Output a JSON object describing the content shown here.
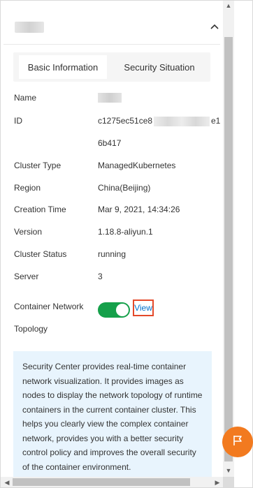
{
  "tabs": [
    {
      "label": "Basic Information",
      "active": true
    },
    {
      "label": "Security Situation",
      "active": false
    }
  ],
  "details": {
    "name_label": "Name",
    "id_label": "ID",
    "id_value_start": "c1275ec51ce8",
    "id_value_end": "e1",
    "id_value_line2": "6b417",
    "cluster_type_label": "Cluster Type",
    "cluster_type_value": "ManagedKubernetes",
    "region_label": "Region",
    "region_value": "China(Beijing)",
    "creation_time_label": "Creation Time",
    "creation_time_value": "Mar 9, 2021, 14:34:26",
    "version_label": "Version",
    "version_value": "1.18.8-aliyun.1",
    "cluster_status_label": "Cluster Status",
    "cluster_status_value": "running",
    "server_label": "Server",
    "server_value": "3",
    "container_network_label_line1": "Container Network",
    "container_network_label_line2": "Topology",
    "view_link": "View"
  },
  "toggle_on": true,
  "info_text": "Security Center provides real-time container network visualization. It provides images as nodes to display the network topology of runtime containers in the current container cluster. This helps you clearly view the complex container network, provides you with a better security control policy and improves the overall security of the container environment.",
  "colors": {
    "toggle": "#15a04a",
    "link": "#0070cc",
    "highlight_border": "#e4492a",
    "fab": "#f27a1f",
    "info_bg": "#e8f4fd"
  },
  "icons": {
    "collapse": "chevron-up-icon",
    "fab": "flag-icon"
  }
}
